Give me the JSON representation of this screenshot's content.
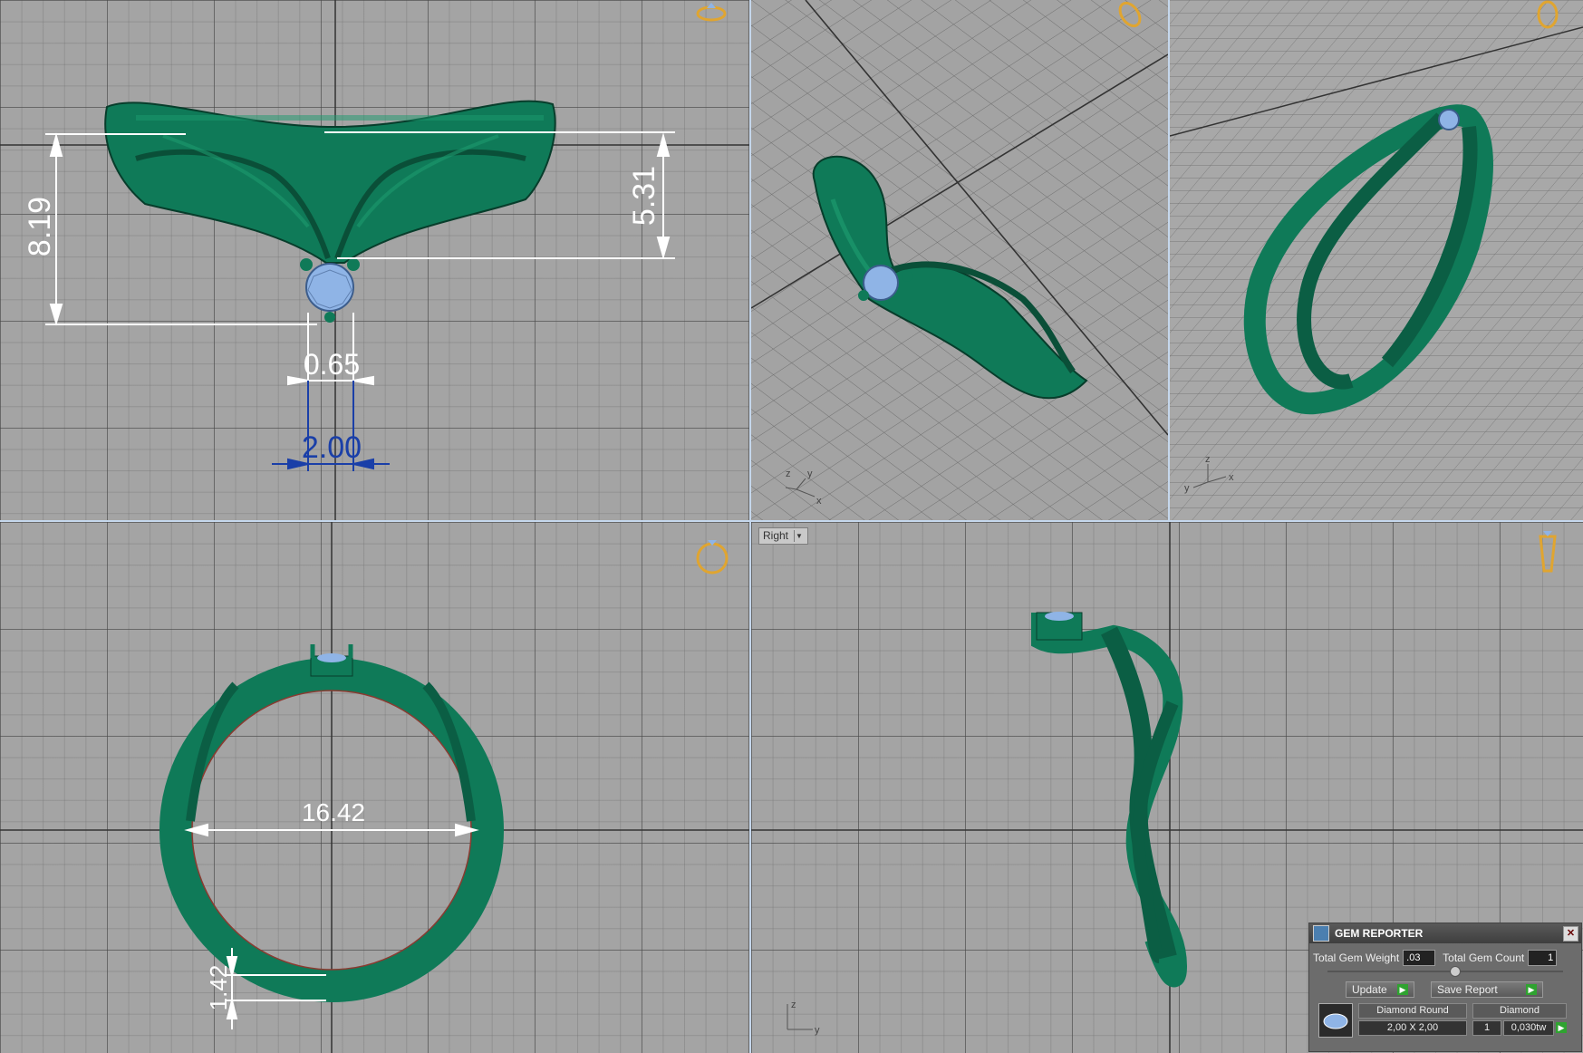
{
  "viewports": {
    "front": {
      "dimensions": {
        "height_total": "8.19",
        "height_upper": "5.31",
        "prong_gap": "0.65",
        "stone_width": "2.00"
      }
    },
    "top": {
      "dimensions": {
        "inner_diameter": "16.42",
        "band_thickness": "1.42"
      }
    },
    "side": {
      "label": "Right",
      "axis": {
        "v": "z",
        "h": "y"
      }
    },
    "perspective1": {
      "axis": {
        "a": "z",
        "b": "y",
        "c": "x"
      }
    },
    "perspective2": {
      "axis": {
        "a": "z",
        "b": "y",
        "c": "x"
      }
    }
  },
  "gem_reporter": {
    "title": "GEM REPORTER",
    "weight_label": "Total Gem Weight",
    "weight_value": ".03",
    "count_label": "Total Gem Count",
    "count_value": "1",
    "update_label": "Update",
    "save_label": "Save Report",
    "col1_header": "Diamond Round",
    "col1_value": "2,00 X 2,00",
    "col2_header": "Diamond",
    "col2_count": "1",
    "col2_weight": "0,030tw"
  },
  "colors": {
    "ring": "#0f7a58",
    "gem": "#8fb4e6",
    "dim_white": "#ffffff",
    "dim_blue": "#1a3fa8",
    "grid_bg": "#a4a4a4",
    "panel_bg": "#6c6c6c"
  },
  "icons": [
    "ring-nav-icon",
    "close-icon",
    "play-icon",
    "gem-thumbnail-icon"
  ]
}
